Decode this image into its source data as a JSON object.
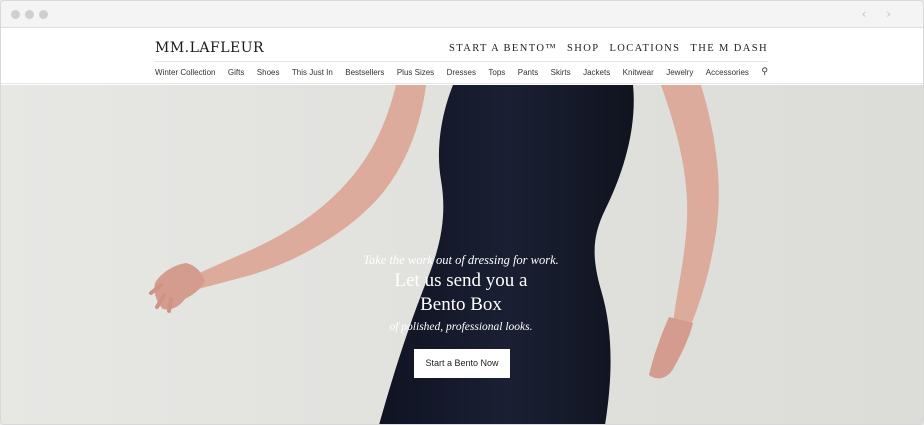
{
  "browser": {
    "nav_arrows": "‹ ›"
  },
  "header": {
    "logo": "MM.LAFLEUR",
    "top_nav": [
      "START A BENTO™",
      "SHOP",
      "LOCATIONS",
      "THE M DASH"
    ],
    "categories": [
      "Winter Collection",
      "Gifts",
      "Shoes",
      "This Just In",
      "Bestsellers",
      "Plus Sizes",
      "Dresses",
      "Tops",
      "Pants",
      "Skirts",
      "Jackets",
      "Knitwear",
      "Jewelry",
      "Accessories"
    ],
    "search_glyph": "⚲"
  },
  "hero": {
    "tagline": "Take the work out of dressing for work.",
    "headline_line1": "Let us send you a",
    "headline_line2": "Bento Box",
    "subline": "of polished, professional looks.",
    "cta_label": "Start a Bento Now"
  },
  "colors": {
    "dress": "#15192a",
    "skin": "#dba99a",
    "background": "#e4e4e1"
  }
}
